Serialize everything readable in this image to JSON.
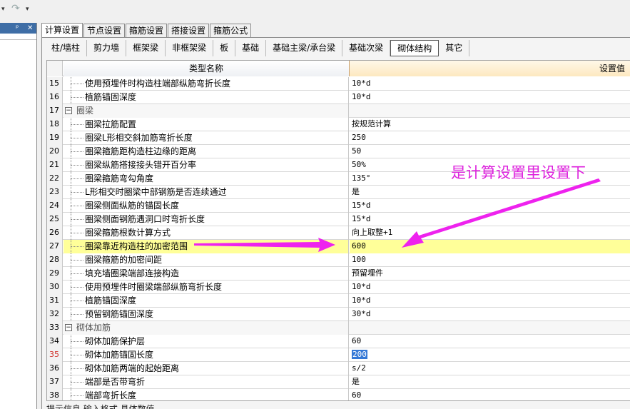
{
  "quick_toolbar": {
    "redo_icon": "redo-icon",
    "dropdown_glyph": "▾"
  },
  "left_panel": {
    "pin_glyph": "ᵖ",
    "close_glyph": "✕"
  },
  "tabs": [
    {
      "label": "计算设置",
      "active": true
    },
    {
      "label": "节点设置",
      "active": false
    },
    {
      "label": "箍筋设置",
      "active": false
    },
    {
      "label": "搭接设置",
      "active": false
    },
    {
      "label": "箍筋公式",
      "active": false
    }
  ],
  "subtabs": [
    {
      "label": "柱/墙柱",
      "active": false
    },
    {
      "label": "剪力墙",
      "active": false
    },
    {
      "label": "框架梁",
      "active": false
    },
    {
      "label": "非框架梁",
      "active": false
    },
    {
      "label": "板",
      "active": false
    },
    {
      "label": "基础",
      "active": false
    },
    {
      "label": "基础主梁/承台梁",
      "active": false
    },
    {
      "label": "基础次梁",
      "active": false
    },
    {
      "label": "砌体结构",
      "active": true
    },
    {
      "label": "其它",
      "active": false
    }
  ],
  "grid": {
    "col_name": "类型名称",
    "col_value": "设置值",
    "rows": [
      {
        "n": "15",
        "name": "使用预埋件时构造柱端部纵筋弯折长度",
        "value": "10*d"
      },
      {
        "n": "16",
        "name": "植筋锚固深度",
        "value": "10*d"
      },
      {
        "n": "17",
        "name": "圈梁",
        "value": "",
        "group": true
      },
      {
        "n": "18",
        "name": "圈梁拉筋配置",
        "value": "按规范计算"
      },
      {
        "n": "19",
        "name": "圈梁L形相交斜加筋弯折长度",
        "value": "250"
      },
      {
        "n": "20",
        "name": "圈梁箍筋距构造柱边缘的距离",
        "value": "50"
      },
      {
        "n": "21",
        "name": "圈梁纵筋搭接接头错开百分率",
        "value": "50%"
      },
      {
        "n": "22",
        "name": "圈梁箍筋弯勾角度",
        "value": "135°"
      },
      {
        "n": "23",
        "name": "L形相交时圈梁中部钢筋是否连续通过",
        "value": "是"
      },
      {
        "n": "24",
        "name": "圈梁侧面纵筋的锚固长度",
        "value": "15*d"
      },
      {
        "n": "25",
        "name": "圈梁侧面钢筋遇洞口时弯折长度",
        "value": "15*d"
      },
      {
        "n": "26",
        "name": "圈梁箍筋根数计算方式",
        "value": "向上取整+1"
      },
      {
        "n": "27",
        "name": "圈梁靠近构造柱的加密范围",
        "value": "600",
        "highlight": true
      },
      {
        "n": "28",
        "name": "圈梁箍筋的加密间距",
        "value": "100"
      },
      {
        "n": "29",
        "name": "填充墙圈梁端部连接构造",
        "value": "预留埋件"
      },
      {
        "n": "30",
        "name": "使用预埋件时圈梁端部纵筋弯折长度",
        "value": "10*d"
      },
      {
        "n": "31",
        "name": "植筋锚固深度",
        "value": "10*d"
      },
      {
        "n": "32",
        "name": "预留钢筋锚固深度",
        "value": "30*d"
      },
      {
        "n": "33",
        "name": "砌体加筋",
        "value": "",
        "group": true
      },
      {
        "n": "34",
        "name": "砌体加筋保护层",
        "value": "60"
      },
      {
        "n": "35",
        "name": "砌体加筋锚固长度",
        "value": "200",
        "selected": true
      },
      {
        "n": "36",
        "name": "砌体加筋两端的起始距离",
        "value": "s/2"
      },
      {
        "n": "37",
        "name": "端部是否带弯折",
        "value": "是"
      },
      {
        "n": "38",
        "name": "端部弯折长度",
        "value": "60"
      }
    ]
  },
  "status_text": "提示信息  输入格式  具体数值",
  "annotation": {
    "text": "是计算设置里设置下",
    "color": "#dd22dd"
  }
}
